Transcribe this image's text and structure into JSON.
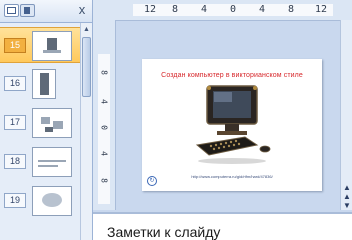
{
  "slides_pane": {
    "tabs": [
      {
        "icon": "slides-tab-icon"
      },
      {
        "icon": "outline-tab-icon"
      }
    ],
    "close_label": "x",
    "thumbnails": [
      {
        "number": "15",
        "selected": true
      },
      {
        "number": "16",
        "selected": false
      },
      {
        "number": "17",
        "selected": false
      },
      {
        "number": "18",
        "selected": false
      },
      {
        "number": "19",
        "selected": false
      }
    ]
  },
  "rulers": {
    "horizontal": [
      "12",
      "8",
      "4",
      "0",
      "4",
      "8",
      "12"
    ],
    "vertical": [
      "8",
      "4",
      "0",
      "4",
      "8"
    ]
  },
  "slide": {
    "title": "Создан компьютер в викторианском стиле",
    "caption": "http://www.computerra.ru/gid/rtfm/hard/47836/"
  },
  "notes": {
    "placeholder": "Заметки к слайду"
  },
  "colors": {
    "selected_thumb": "#ffc95c",
    "slide_title": "#d7282c",
    "window_bg": "#c9d8ee"
  }
}
